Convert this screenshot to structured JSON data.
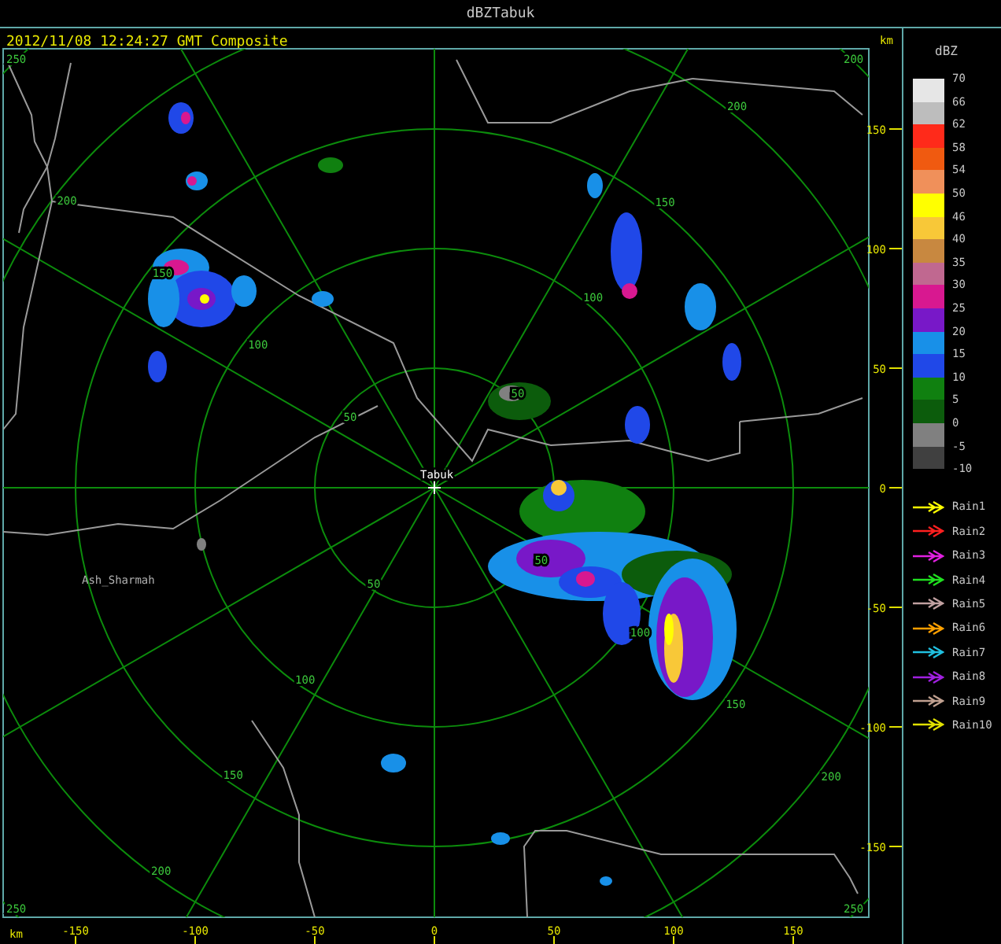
{
  "window": {
    "title": "dBZTabuk"
  },
  "header": {
    "timestamp": "2012/11/08 12:24:27 GMT Composite"
  },
  "plot": {
    "range_labels": [
      "50",
      "50",
      "50",
      "50",
      "100",
      "100",
      "100",
      "100",
      "150",
      "150",
      "150",
      "150",
      "200",
      "200",
      "200",
      "200"
    ],
    "corner_labels": [
      "250",
      "200",
      "250",
      "250"
    ],
    "places": [
      {
        "kind": "radar",
        "name": "Tabuk"
      },
      {
        "kind": "town",
        "name": "Ash_Sharmah"
      }
    ]
  },
  "right_axis": {
    "unit": "km",
    "ticks": [
      "150",
      "100",
      "50",
      "0",
      "-50",
      "-100",
      "-150"
    ]
  },
  "bottom_axis": {
    "unit": "km",
    "ticks": [
      "-150",
      "-100",
      "-50",
      "0",
      "50",
      "100",
      "150"
    ]
  },
  "legend": {
    "title": "dBZ",
    "last_label": "-10",
    "levels": [
      {
        "label": "70",
        "color": "#e6e6e6"
      },
      {
        "label": "66",
        "color": "#bdbdbd"
      },
      {
        "label": "62",
        "color": "#ff2a1a"
      },
      {
        "label": "58",
        "color": "#f05a10"
      },
      {
        "label": "54",
        "color": "#f0905a"
      },
      {
        "label": "50",
        "color": "#ffff00"
      },
      {
        "label": "46",
        "color": "#f8c838"
      },
      {
        "label": "40",
        "color": "#c88840"
      },
      {
        "label": "35",
        "color": "#c06890"
      },
      {
        "label": "30",
        "color": "#d81890"
      },
      {
        "label": "25",
        "color": "#7818c8"
      },
      {
        "label": "20",
        "color": "#1890e8"
      },
      {
        "label": "15",
        "color": "#2048e8"
      },
      {
        "label": "10",
        "color": "#108010"
      },
      {
        "label": "5",
        "color": "#0c5c0c"
      },
      {
        "label": "0",
        "color": "#808080"
      },
      {
        "label": "-5",
        "color": "#404040"
      }
    ]
  },
  "tracks": [
    {
      "label": "Rain1",
      "color": "#ffff00"
    },
    {
      "label": "Rain2",
      "color": "#ff2020"
    },
    {
      "label": "Rain3",
      "color": "#e020e0"
    },
    {
      "label": "Rain4",
      "color": "#20e020"
    },
    {
      "label": "Rain5",
      "color": "#c0a0a0"
    },
    {
      "label": "Rain6",
      "color": "#ffa000"
    },
    {
      "label": "Rain7",
      "color": "#20c0e0"
    },
    {
      "label": "Rain8",
      "color": "#a020e0"
    },
    {
      "label": "Rain9",
      "color": "#c0a090"
    },
    {
      "label": "Rain10",
      "color": "#e0e000"
    }
  ]
}
